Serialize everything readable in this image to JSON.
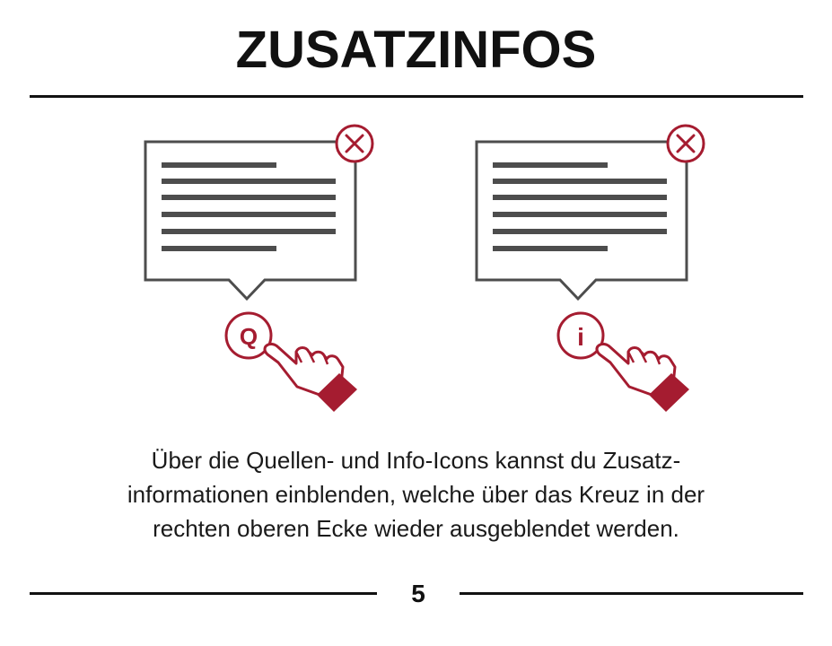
{
  "title": "ZUSATZINFOS",
  "description": "Über die Quellen- und Info-Icons kannst du Zusatz- informationen einblenden, welche über das Kreuz in der rechten oberen Ecke wieder ausgeblendet werden.",
  "description_lines": [
    "Über die Quellen- und Info-Icons kannst du Zusatz-",
    "informationen einblenden, welche über das Kreuz in der",
    "rechten oberen Ecke wieder ausgeblendet werden."
  ],
  "panels": [
    {
      "icon_letter": "Q",
      "icon_name": "source-icon"
    },
    {
      "icon_letter": "i",
      "icon_name": "info-icon"
    }
  ],
  "page_number": "5",
  "colors": {
    "accent": "#a51c30",
    "gray": "#4d4d4d",
    "text": "#111111"
  }
}
